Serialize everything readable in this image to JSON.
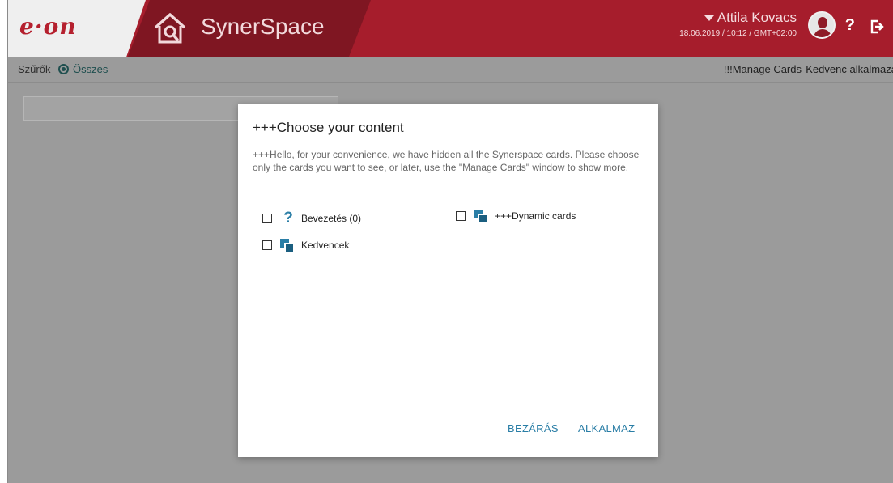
{
  "header": {
    "logo_text": "e·on",
    "app_title": "SynerSpace",
    "user_name": "Attila Kovacs",
    "datetime": "18.06.2019 / 10:12 / GMT+02:00",
    "help_label": "?",
    "icons": [
      "home-icon",
      "avatar",
      "help-icon",
      "logout-icon"
    ],
    "colors": {
      "primary": "#a61d2c",
      "dark": "#7f1622",
      "accent": "#2a7ea6"
    }
  },
  "filterbar": {
    "filters_label": "Szűrők",
    "radio_label": "Összes",
    "manage_cards": "!!!Manage Cards",
    "favorite_apps": "Kedvenc alkalmazá"
  },
  "dialog": {
    "title": "+++Choose your content",
    "description": "+++Hello, for your convenience, we have hidden all the Synerspace cards. Please choose only the cards you want to see, or later, use the \"Manage Cards\" window to show more.",
    "options": [
      {
        "label": "Bevezetés (0)",
        "icon": "question-icon",
        "checked": false
      },
      {
        "label": "+++Dynamic cards",
        "icon": "cards-icon",
        "checked": false
      },
      {
        "label": "Kedvencek",
        "icon": "cards-icon",
        "checked": false
      }
    ],
    "close_label": "BEZÁRÁS",
    "apply_label": "ALKALMAZ"
  }
}
